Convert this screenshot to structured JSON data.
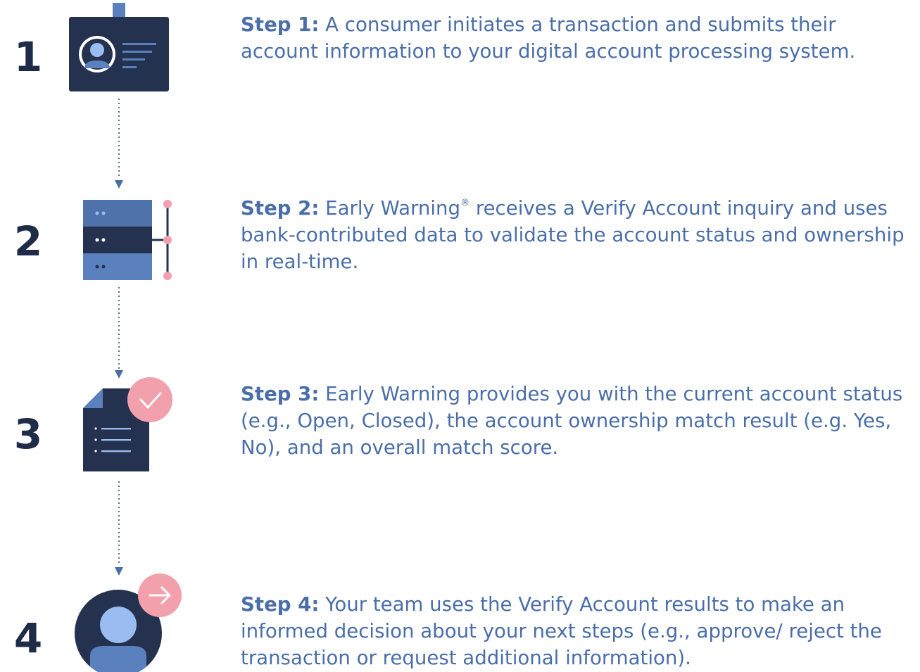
{
  "steps": [
    {
      "number": "1",
      "label": "Step 1:",
      "text_before": " A consumer initiates a transaction and submits their account information to your digital account processing system.",
      "superscript": "",
      "text_after": "",
      "icon": "id-badge-icon"
    },
    {
      "number": "2",
      "label": "Step 2:",
      "text_before": " Early Warning",
      "superscript": "®",
      "text_after": " receives a Verify Account inquiry and uses bank-contributed data to validate the account status and ownership in real-time.",
      "icon": "server-icon"
    },
    {
      "number": "3",
      "label": "Step 3:",
      "text_before": " Early Warning provides you with the current account status (e.g., Open, Closed), the account ownership match result (e.g. Yes, No), and an overall match score.",
      "superscript": "",
      "text_after": "",
      "icon": "document-check-icon"
    },
    {
      "number": "4",
      "label": "Step 4:",
      "text_before": " Your team uses the Verify Account results to make an informed decision about your next steps (e.g., approve/ reject the transaction or request additional information).",
      "superscript": "",
      "text_after": "",
      "icon": "user-arrow-icon"
    }
  ],
  "connector_icon": "dotted-arrow-icon",
  "colors": {
    "navy": "#24324f",
    "blue": "#4a6ea8",
    "mid_blue": "#5a80bd",
    "light_blue": "#9bbcf0",
    "pink": "#f2a0ac",
    "connector": "#4a6ea8"
  }
}
